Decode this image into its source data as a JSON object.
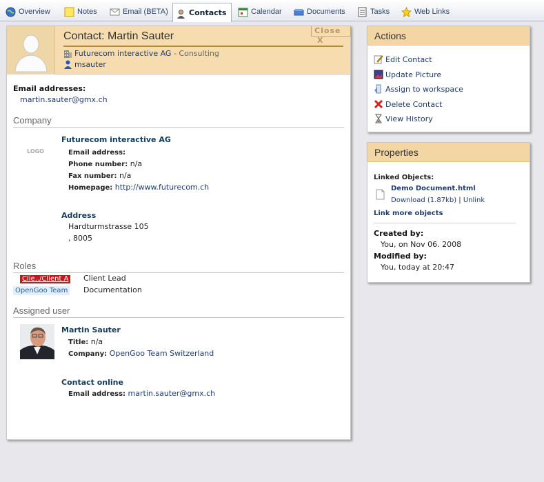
{
  "tabs": [
    {
      "label": "Overview",
      "icon": "globe-icon"
    },
    {
      "label": "Notes",
      "icon": "notes-icon"
    },
    {
      "label": "Email (BETA)",
      "icon": "email-icon"
    },
    {
      "label": "Contacts",
      "icon": "contacts-icon",
      "active": true
    },
    {
      "label": "Calendar",
      "icon": "calendar-icon"
    },
    {
      "label": "Documents",
      "icon": "documents-icon"
    },
    {
      "label": "Tasks",
      "icon": "tasks-icon"
    },
    {
      "label": "Web Links",
      "icon": "star-icon"
    }
  ],
  "contact": {
    "title": "Contact: Martin Sauter",
    "close_label": "Close",
    "close_x": "X",
    "company": "Futurecom interactive AG",
    "department": " - Consulting",
    "username": "msauter",
    "email_label": "Email addresses:",
    "email": "martin.sauter@gmx.ch"
  },
  "company_section": {
    "title": "Company",
    "logo_label": "LOGO",
    "name": "Futurecom interactive AG",
    "email_label": "Email address:",
    "email_value": "",
    "phone_label": "Phone number:",
    "phone_value": "n/a",
    "fax_label": "Fax number:",
    "fax_value": "n/a",
    "homepage_label": "Homepage:",
    "homepage_value": "http://www.futurecom.ch",
    "address_title": "Address",
    "street": "Hardturmstrasse 105",
    "city_zip": ", 8005"
  },
  "roles": {
    "title": "Roles",
    "items": [
      {
        "tag": "Clie../Client A",
        "role": "Client Lead"
      },
      {
        "tag": "OpenGoo Team",
        "role": "Documentation"
      }
    ]
  },
  "assigned_user": {
    "title": "Assigned user",
    "name": "Martin Sauter",
    "title_label": "Title:",
    "title_value": "n/a",
    "company_label": "Company:",
    "company_value": "OpenGoo Team Switzerland",
    "online_title": "Contact online",
    "email_label": "Email address:",
    "email_value": "martin.sauter@gmx.ch"
  },
  "actions": {
    "title": "Actions",
    "items": [
      {
        "label": "Edit Contact",
        "icon": "edit-icon"
      },
      {
        "label": "Update Picture",
        "icon": "picture-icon"
      },
      {
        "label": "Assign to workspace",
        "icon": "workspace-icon"
      },
      {
        "label": "Delete Contact",
        "icon": "delete-icon"
      },
      {
        "label": "View History",
        "icon": "hourglass-icon"
      }
    ]
  },
  "properties": {
    "title": "Properties",
    "linked_label": "Linked Objects:",
    "doc_name": "Demo Document.html",
    "download_label": "Download (1.87kb)",
    "separator": " | ",
    "unlink_label": "Unlink",
    "link_more": "Link more objects",
    "created_label": "Created by:",
    "created_value": "You, on Nov 06. 2008",
    "modified_label": "Modified by:",
    "modified_value": "You, today at 20:47"
  }
}
